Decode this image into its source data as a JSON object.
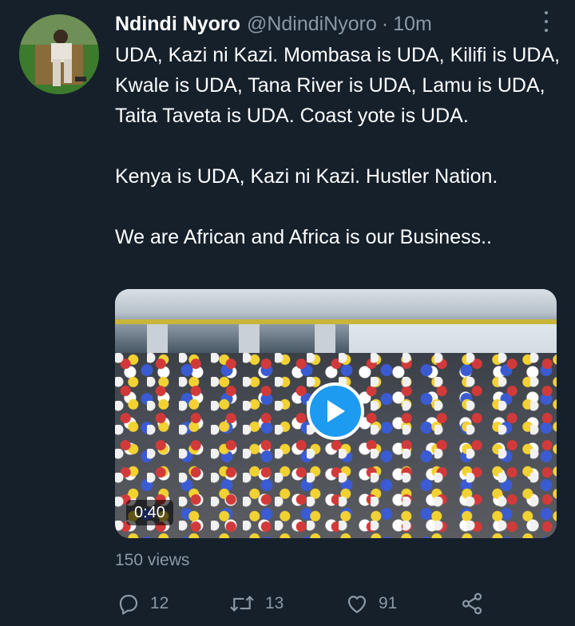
{
  "tweet": {
    "author_name": "Ndindi Nyoro",
    "handle": "@NdindiNyoro",
    "separator": "·",
    "time": "10m",
    "paragraphs": [
      "UDA, Kazi ni Kazi. Mombasa is UDA, Kilifi is UDA, Kwale is UDA, Tana River is UDA, Lamu is UDA, Taita Taveta is UDA. Coast yote is UDA.",
      "Kenya is UDA, Kazi ni Kazi. Hustler Nation.",
      "We are African and Africa is our Business.."
    ],
    "video": {
      "duration": "0:40"
    },
    "views": "150 views",
    "actions": {
      "reply_count": "12",
      "retweet_count": "13",
      "like_count": "91"
    }
  },
  "icons": {
    "more": "more-vertical-icon",
    "reply": "reply-icon",
    "retweet": "retweet-icon",
    "like": "heart-icon",
    "share": "share-icon",
    "play": "play-icon"
  },
  "colors": {
    "background": "#15202b",
    "text": "#ffffff",
    "secondary": "#8b98a5",
    "accent": "#1d9bf0"
  }
}
